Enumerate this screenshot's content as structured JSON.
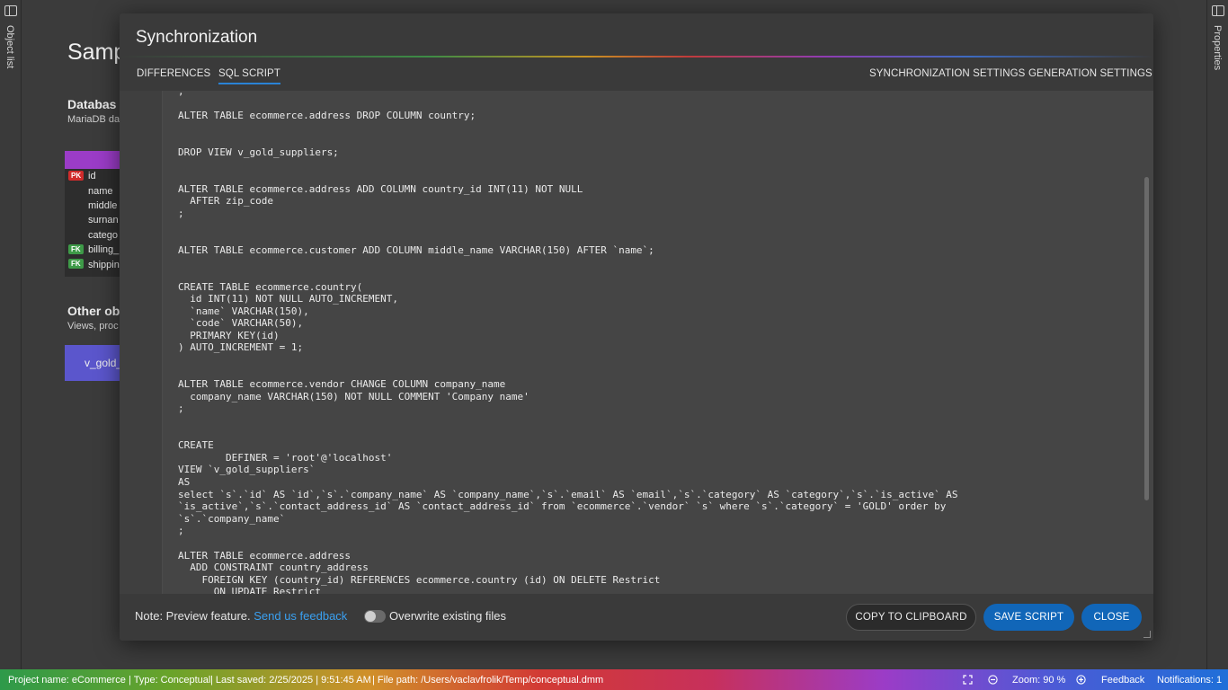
{
  "side_panels": {
    "left_label": "Object list",
    "right_label": "Properties"
  },
  "background": {
    "title": "Samp",
    "database_heading": "Databas",
    "database_sub": "MariaDB da",
    "entity_rows": [
      {
        "badge": "PK",
        "label": "id"
      },
      {
        "badge": "",
        "label": "name"
      },
      {
        "badge": "",
        "label": "middle"
      },
      {
        "badge": "",
        "label": "surnan"
      },
      {
        "badge": "",
        "label": "catego"
      },
      {
        "badge": "FK",
        "label": "billing_"
      },
      {
        "badge": "FK",
        "label": "shippin"
      }
    ],
    "other_heading": "Other ob",
    "other_sub": "Views, proc",
    "view_label": "v_gold_"
  },
  "modal": {
    "title": "Synchronization",
    "tabs": {
      "differences": "DIFFERENCES",
      "sql_script": "SQL SCRIPT",
      "sync_settings": "SYNCHRONIZATION SETTINGS",
      "gen_settings": "GENERATION SETTINGS"
    },
    "sql_script": ";\n\nALTER TABLE ecommerce.address DROP COLUMN country;\n\n\nDROP VIEW v_gold_suppliers;\n\n\nALTER TABLE ecommerce.address ADD COLUMN country_id INT(11) NOT NULL\n  AFTER zip_code\n;\n\n\nALTER TABLE ecommerce.customer ADD COLUMN middle_name VARCHAR(150) AFTER `name`;\n\n\nCREATE TABLE ecommerce.country(\n  id INT(11) NOT NULL AUTO_INCREMENT,\n  `name` VARCHAR(150),\n  `code` VARCHAR(50),\n  PRIMARY KEY(id)\n) AUTO_INCREMENT = 1;\n\n\nALTER TABLE ecommerce.vendor CHANGE COLUMN company_name\n  company_name VARCHAR(150) NOT NULL COMMENT 'Company name'\n;\n\n\nCREATE\n        DEFINER = 'root'@'localhost'\nVIEW `v_gold_suppliers`\nAS\nselect `s`.`id` AS `id`,`s`.`company_name` AS `company_name`,`s`.`email` AS `email`,`s`.`category` AS `category`,`s`.`is_active` AS\n`is_active`,`s`.`contact_address_id` AS `contact_address_id` from `ecommerce`.`vendor` `s` where `s`.`category` = 'GOLD' order by\n`s`.`company_name`\n;\n\nALTER TABLE ecommerce.address\n  ADD CONSTRAINT country_address\n    FOREIGN KEY (country_id) REFERENCES ecommerce.country (id) ON DELETE Restrict\n      ON UPDATE Restrict",
    "footer": {
      "note": "Note: Preview feature. ",
      "feedback_link": "Send us feedback",
      "toggle_label": "Overwrite existing files",
      "overwrite_enabled": false,
      "copy_button": "COPY TO CLIPBOARD",
      "save_button": "SAVE SCRIPT",
      "close_button": "CLOSE"
    }
  },
  "statusbar": {
    "project": "Project name: eCommerce",
    "type": "| Type: Conceptual",
    "last_saved": "| Last saved: 2/25/2025 | 9:51:45 AM",
    "file_path": "| File path: /Users/vaclavfrolik/Temp/conceptual.dmm",
    "zoom": "Zoom: 90 %",
    "feedback": "Feedback",
    "notifications": "Notifications: 1"
  },
  "icons": [
    "panel-toggle-icon",
    "fullscreen-icon",
    "zoom-out-icon",
    "zoom-in-icon"
  ]
}
